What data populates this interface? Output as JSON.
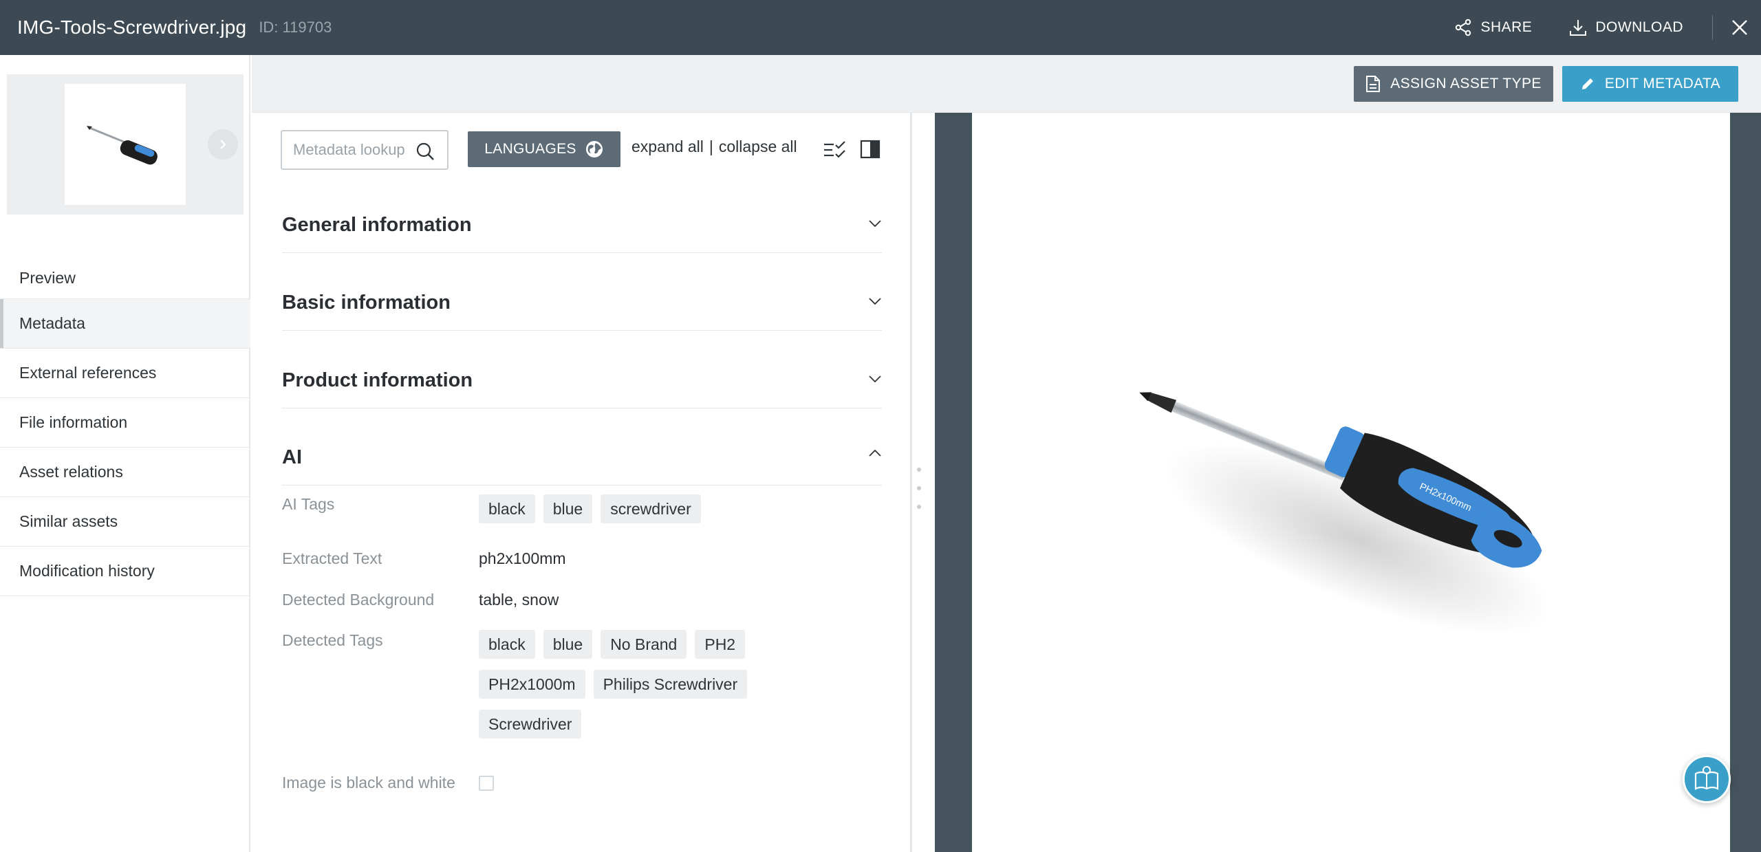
{
  "header": {
    "title": "IMG-Tools-Screwdriver.jpg",
    "asset_id": "ID: 119703",
    "share_label": "SHARE",
    "download_label": "DOWNLOAD"
  },
  "toolbar": {
    "assign_label": "ASSIGN ASSET TYPE",
    "edit_label": "EDIT METADATA"
  },
  "sidebar": {
    "items": [
      {
        "label": "Preview"
      },
      {
        "label": "Metadata"
      },
      {
        "label": "External references"
      },
      {
        "label": "File information"
      },
      {
        "label": "Asset relations"
      },
      {
        "label": "Similar assets"
      },
      {
        "label": "Modification history"
      }
    ],
    "active_index": 1
  },
  "metadata": {
    "search_placeholder": "Metadata lookup",
    "languages_label": "LANGUAGES",
    "expand_all": "expand all",
    "separator": "|",
    "collapse_all": "collapse all",
    "sections": [
      {
        "title": "General information",
        "expanded": false
      },
      {
        "title": "Basic information",
        "expanded": false
      },
      {
        "title": "Product information",
        "expanded": false
      },
      {
        "title": "AI",
        "expanded": true
      }
    ],
    "ai": {
      "ai_tags_label": "AI Tags",
      "ai_tags": [
        "black",
        "blue",
        "screwdriver"
      ],
      "extracted_text_label": "Extracted Text",
      "extracted_text": "ph2x100mm",
      "detected_background_label": "Detected Background",
      "detected_background": "table, snow",
      "detected_tags_label": "Detected Tags",
      "detected_tags": [
        "black",
        "blue",
        "No Brand",
        "PH2",
        "PH2x1000m",
        "Philips Screwdriver",
        "Screwdriver"
      ],
      "black_white_label": "Image is black and white",
      "black_white": false
    }
  },
  "preview": {
    "handle_text": "PH2x100mm"
  },
  "colors": {
    "topbar": "#3d4a53",
    "accent": "#3aa0c9",
    "button_dark": "#5c6b76",
    "preview_bg": "#45535c"
  },
  "icons": {
    "share": "share-icon",
    "download": "download-icon",
    "close": "close-icon",
    "search": "search-icon",
    "globe": "globe-icon",
    "checklist": "checklist-icon",
    "panel": "panel-toggle-icon",
    "chevron": "chevron-down-icon",
    "help": "help-book-icon"
  }
}
